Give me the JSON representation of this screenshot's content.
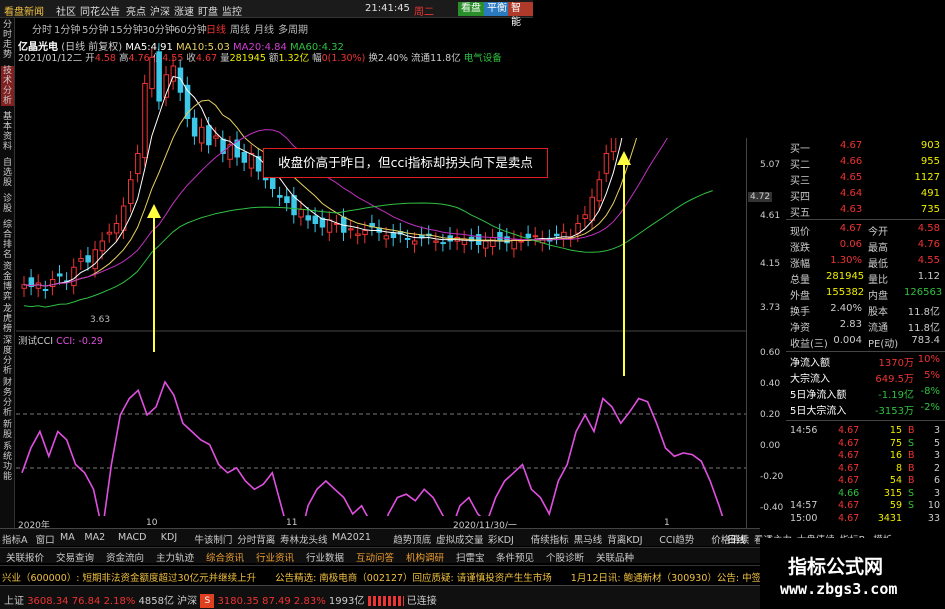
{
  "topbar": {
    "brand": "看盘新闻",
    "menus": [
      "社区",
      "同花公告",
      "亮点",
      "沪深",
      "涨速",
      "盯盘",
      "监控"
    ],
    "time": "21:41:45",
    "weekday": "周二",
    "btn_kanpan": "看盘",
    "btn_pingheng": "平衡",
    "btn_zhineng": "智能"
  },
  "periods": [
    "分时",
    "1分钟",
    "5分钟",
    "15分钟",
    "30分钟",
    "60分钟",
    "日线",
    "周线",
    "月线",
    "多周期"
  ],
  "active_period": "日线",
  "left_tabs": [
    "分时走势",
    "技术分析",
    "基本资料",
    "自选股",
    "诊股",
    "综合排名",
    "资金博弈",
    "龙虎榜",
    "深度分析",
    "财务分析",
    "新股",
    "系统功能"
  ],
  "stock": {
    "name": "亿晶光电",
    "mode": "(日线 前复权)",
    "ma5_label": "MA5:",
    "ma5": "4.91",
    "ma10_label": "MA10:",
    "ma10": "5.03",
    "ma20_label": "MA20:",
    "ma20": "4.84",
    "ma60_label": "MA60:",
    "ma60": "4.32"
  },
  "info_row": {
    "date": "2021/01/12二",
    "open_label": "开",
    "open": "4.58",
    "high_label": "高",
    "high": "4.76",
    "low_label": "低",
    "low": "4.55",
    "close_label": "收",
    "close": "4.67",
    "vol_label": "量",
    "vol": "281945",
    "amt_label": "额",
    "amt": "1.32亿",
    "chg_label": "幅",
    "chg": "0(1.30%)",
    "turn_label": "换",
    "turn": "2.40%",
    "float_label": "流通",
    "float": "11.8亿",
    "industry": "电气设备"
  },
  "annotation": "收盘价高于昨日，但cci指标却拐头向下是卖点",
  "cci": {
    "title": "测试CCI",
    "label": "CCI: -0.29"
  },
  "price_ticks": [
    "5.07",
    "4.72",
    "4.61",
    "4.15",
    "3.73"
  ],
  "cci_ticks": [
    "0.60",
    "0.40",
    "0.20",
    "0.00",
    "-0.20",
    "-0.40"
  ],
  "low_marker": "3.63",
  "x_labels": [
    "2020年",
    "10",
    "11",
    "2020/11/30/一",
    "1"
  ],
  "chart_data": {
    "type": "candlestick",
    "series": [
      {
        "name": "MA5",
        "values": []
      },
      {
        "name": "MA10",
        "values": []
      },
      {
        "name": "MA20",
        "values": []
      },
      {
        "name": "MA60",
        "values": []
      },
      {
        "name": "CCI",
        "values": []
      }
    ],
    "ylim": [
      3.6,
      5.2
    ],
    "cci_ylim": [
      -0.45,
      0.65
    ]
  },
  "orderbook": [
    {
      "label": "买一",
      "price": "4.67",
      "vol": "903"
    },
    {
      "label": "买二",
      "price": "4.66",
      "vol": "955"
    },
    {
      "label": "买三",
      "price": "4.65",
      "vol": "1127"
    },
    {
      "label": "买四",
      "price": "4.64",
      "vol": "491"
    },
    {
      "label": "买五",
      "price": "4.63",
      "vol": "735"
    }
  ],
  "stats": [
    {
      "l1": "现价",
      "v1": "4.67",
      "l2": "今开",
      "v2": "4.58"
    },
    {
      "l1": "涨跌",
      "v1": "0.06",
      "l2": "最高",
      "v2": "4.76"
    },
    {
      "l1": "涨幅",
      "v1": "1.30%",
      "l2": "最低",
      "v2": "4.55"
    },
    {
      "l1": "总量",
      "v1": "281945",
      "l2": "量比",
      "v2": "1.12"
    },
    {
      "l1": "外盘",
      "v1": "155382",
      "l2": "内盘",
      "v2": "126563"
    },
    {
      "l1": "换手",
      "v1": "2.40%",
      "l2": "股本",
      "v2": "11.8亿"
    },
    {
      "l1": "净资",
      "v1": "2.83",
      "l2": "流通",
      "v2": "11.8亿"
    },
    {
      "l1": "收益(三)",
      "v1": "0.004",
      "l2": "PE(动)",
      "v2": "783.4"
    }
  ],
  "flows": [
    {
      "label": "净流入额",
      "value": "1370万",
      "pct": "10%"
    },
    {
      "label": "大宗流入",
      "value": "649.5万",
      "pct": "5%"
    },
    {
      "label": "5日净流入额",
      "value": "-1.19亿",
      "pct": "-8%"
    },
    {
      "label": "5日大宗流入",
      "value": "-3153万",
      "pct": "-2%"
    }
  ],
  "ticks": [
    {
      "time": "14:56",
      "price": "4.67",
      "vol": "15",
      "side": "B",
      "n": "3"
    },
    {
      "time": "",
      "price": "4.67",
      "vol": "75",
      "side": "S",
      "n": "5"
    },
    {
      "time": "",
      "price": "4.67",
      "vol": "16",
      "side": "B",
      "n": "3"
    },
    {
      "time": "",
      "price": "4.67",
      "vol": "8",
      "side": "B",
      "n": "2"
    },
    {
      "time": "",
      "price": "4.67",
      "vol": "54",
      "side": "B",
      "n": "6"
    },
    {
      "time": "",
      "price": "4.66",
      "vol": "315",
      "side": "S",
      "n": "3"
    },
    {
      "time": "14:57",
      "price": "4.67",
      "vol": "59",
      "side": "S",
      "n": "10"
    },
    {
      "time": "15:00",
      "price": "4.67",
      "vol": "3431",
      "side": "",
      "n": "33"
    }
  ],
  "indicator_tabs": [
    "指标A",
    "窗口",
    "MA",
    "MA2",
    "MACD",
    "KDJ",
    "牛该制门",
    "分时背离",
    "寿林龙头线",
    "MA2021",
    "趋势顶底",
    "虚拟成交量",
    "彩KDJ",
    "倩续指标",
    "黑马线",
    "背离KDJ",
    "CCI趋势",
    "价格倩续",
    "看透主力",
    "大盘倩续",
    "指标B",
    "模析"
  ],
  "right_tab": "日线",
  "func_tabs": [
    "关联报价",
    "交易查询",
    "资金流向",
    "主力轨迹",
    "综合资讯",
    "行业资讯",
    "行业数据",
    "互动问答",
    "机构调研",
    "扫雷宝",
    "条件预见",
    "个股诊断",
    "关联品种"
  ],
  "news": "兴业（600000）: 短期非法资金额度超过30亿元并继续上升　　公告精选: 南极电商（002127）回应质疑: 请谨慎投资产生生市场　　1月12日讯: 鲍通新材（300930）公告: 中签号码共有...",
  "status": {
    "sh_label": "上证",
    "sh": "3608.34",
    "sh_chg": "76.84",
    "sh_pct": "2.18%",
    "sh_amt": "4858亿",
    "sz_label": "沪深",
    "sz": "3180.35",
    "sz_chg": "87.49",
    "sz_pct": "2.83%",
    "sz_amt": "1993亿",
    "conn": "已连接"
  },
  "watermark": {
    "title": "指标公式网",
    "url": "www.zbgs3.com"
  }
}
